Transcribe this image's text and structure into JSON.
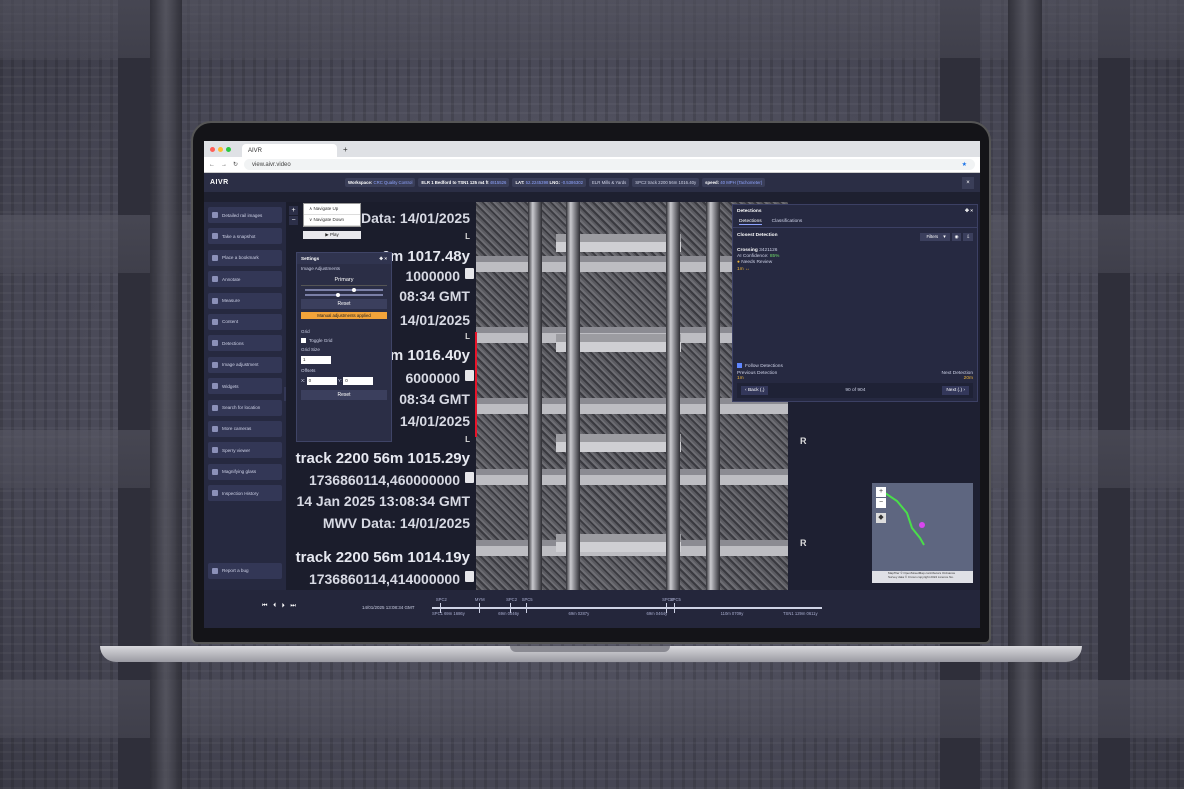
{
  "browser": {
    "tab_title": "AIVR",
    "new_tab": "+",
    "url": "view.aivr.video"
  },
  "header": {
    "logo": "AIVR",
    "workspace_label": "Workspace:",
    "workspace_value": "CRC Quality Control",
    "elr": "ELR 1 Bedford to TSN1 125 m4 ft",
    "elr_value": "4815526",
    "lat_label": "LAT:",
    "lat_value": "52.2245398",
    "lng_label": "LNG:",
    "lng_value": "-0.5386302",
    "area": "ELR Mills & Yards",
    "track": "SPC2 track 2200 56m 1016.40y",
    "speed_label": "speed:",
    "speed_value": "40 MPH (Tachometer)",
    "close": "×"
  },
  "sidebar": {
    "items": [
      {
        "label": "Detailed rail images",
        "icon": "rail-icon"
      },
      {
        "label": "Take a snapshot",
        "icon": "camera-icon"
      },
      {
        "label": "Place a bookmark",
        "icon": "bookmark-icon"
      },
      {
        "label": "Annotate",
        "icon": "annotate-icon"
      },
      {
        "label": "Measure",
        "icon": "ruler-icon"
      },
      {
        "label": "Content",
        "icon": "content-icon"
      },
      {
        "label": "Detections",
        "icon": "detection-icon"
      },
      {
        "label": "Image adjustment",
        "icon": "image-icon"
      },
      {
        "label": "Widgets",
        "icon": "widget-icon"
      },
      {
        "label": "Search for location",
        "icon": "search-icon"
      },
      {
        "label": "More cameras",
        "icon": "camera-icon"
      },
      {
        "label": "Sperry viewer",
        "icon": "rail-icon"
      },
      {
        "label": "Magnifying glass",
        "icon": "magnify-icon"
      },
      {
        "label": "Inspection History",
        "icon": "history-icon"
      }
    ],
    "report": "Report a bug"
  },
  "nav_popup": {
    "up": "Navigate Up",
    "down": "Navigate Down",
    "play": "Play",
    "zoom_in": "+",
    "zoom_out": "−"
  },
  "overlay_text": {
    "lines": [
      "Data: 14/01/2025",
      "6m 1017.48y",
      "1000000",
      "08:34 GMT",
      "14/01/2025",
      "6m 1016.40y",
      "6000000",
      "08:34 GMT",
      "14/01/2025",
      "track 2200 56m 1015.29y",
      "1736860114,460000000",
      "14 Jan 2025 13:08:34 GMT",
      "MWV Data: 14/01/2025",
      "track 2200 56m 1014.19y",
      "1736860114,414000000"
    ],
    "L": "L",
    "R": "R"
  },
  "settings": {
    "title": "Settings",
    "section": "Image Adjustments",
    "tab": "Primary",
    "brightness": 0.6,
    "contrast": 0.4,
    "reset": "Reset",
    "warning": "Manual adjustments applied",
    "grid_title": "Grid",
    "toggle_grid": "Toggle Grid",
    "grid_size_label": "Grid Size",
    "grid_size": "1",
    "offsets_label": "Offsets",
    "x_label": "X:",
    "x_value": "0",
    "y_label": "Y:",
    "y_value": "0",
    "reset2": "Reset"
  },
  "detections": {
    "title": "Detections",
    "tab_detections": "Detections",
    "tab_classifications": "Classifications",
    "closest": "Closest Detection",
    "filters": "Filters",
    "type": "Crossing",
    "id": "3421126",
    "confidence_label": "AI Confidence:",
    "confidence": "85%",
    "status": "Needs Review",
    "distance": "1m",
    "follow": "Follow Detections",
    "prev_label": "Previous Detection",
    "prev_dist": "1m",
    "next_label": "Next Detection",
    "next_dist": "20m",
    "back": "Back (,)",
    "count": "90 of 904",
    "next": "Next (.)"
  },
  "minimap": {
    "zoom_in": "+",
    "zoom_out": "−",
    "attribution": "MapTiler © OpenStreetMap contributors Ordnance Survey data © Crown copyright 2024 Licence No."
  },
  "timeline": {
    "date": "14/01/2025 13:08:34 GMT",
    "markers": [
      "SPC2",
      "MYM",
      "SPC2",
      "SPC5",
      "SPC4",
      "SPC5"
    ],
    "bottom_labels": [
      "SPC1 69m 1686y",
      "69m 0046y",
      "69m 0287y",
      "69m 0464y",
      "110m 0709y",
      "TSN1 129m 0611y"
    ]
  },
  "colors": {
    "accent": "#8fa4ff",
    "warning": "#f2a33a",
    "red_marker": "#e8142a",
    "confidence": "#6fdc6a"
  }
}
